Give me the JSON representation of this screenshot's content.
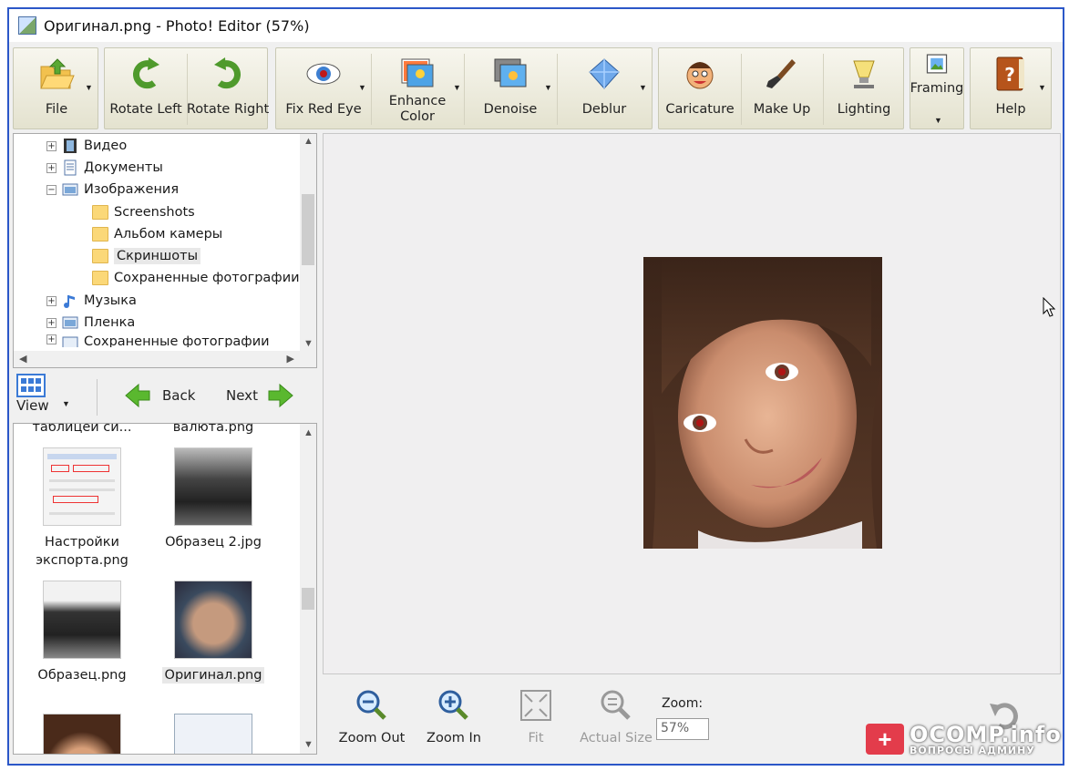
{
  "window": {
    "title": "Оригинал.png - Photo! Editor (57%)"
  },
  "toolbar": {
    "file": "File",
    "rotate_left": "Rotate Left",
    "rotate_right": "Rotate Right",
    "fix_red_eye": "Fix Red Eye",
    "enhance_color_1": "Enhance",
    "enhance_color_2": "Color",
    "denoise": "Denoise",
    "deblur": "Deblur",
    "caricature": "Caricature",
    "make_up": "Make Up",
    "lighting": "Lighting",
    "framing": "Framing",
    "help": "Help"
  },
  "tree": {
    "items": [
      {
        "label": "Видео",
        "icon": "film-icon"
      },
      {
        "label": "Документы",
        "icon": "document-icon"
      },
      {
        "label": "Изображения",
        "icon": "pictures-icon"
      },
      {
        "label": "Screenshots",
        "icon": "folder-icon"
      },
      {
        "label": "Альбом камеры",
        "icon": "folder-icon"
      },
      {
        "label": "Скриншоты",
        "icon": "folder-icon"
      },
      {
        "label": "Сохраненные фотографии",
        "icon": "folder-icon"
      },
      {
        "label": "Музыка",
        "icon": "music-icon"
      },
      {
        "label": "Пленка",
        "icon": "pictures-icon"
      },
      {
        "label": "Сохраненные фотографии",
        "icon": "pictures-icon"
      }
    ]
  },
  "nav": {
    "view": "View",
    "back": "Back",
    "next": "Next"
  },
  "thumbnails": {
    "top_1": "таблицей си...",
    "top_2": "валюта.png",
    "items": [
      {
        "line1": "Настройки",
        "line2": "экспорта.png"
      },
      {
        "line1": "Образец 2.jpg",
        "line2": ""
      },
      {
        "line1": "Образец.png",
        "line2": ""
      },
      {
        "line1": "Оригинал.png",
        "line2": ""
      }
    ]
  },
  "zoombar": {
    "zoom_out": "Zoom Out",
    "zoom_in": "Zoom In",
    "fit": "Fit",
    "actual_size": "Actual Size",
    "zoom_label": "Zoom:",
    "zoom_value": "57%"
  },
  "watermark": {
    "main": "OCOMP.info",
    "sub": "ВОПРОСЫ АДМИНУ"
  },
  "colors": {
    "window_border": "#2b57c8",
    "toolbar_bg": "#e4e2cf",
    "accent_green": "#5aa832",
    "watermark_red": "#e33c4b"
  }
}
